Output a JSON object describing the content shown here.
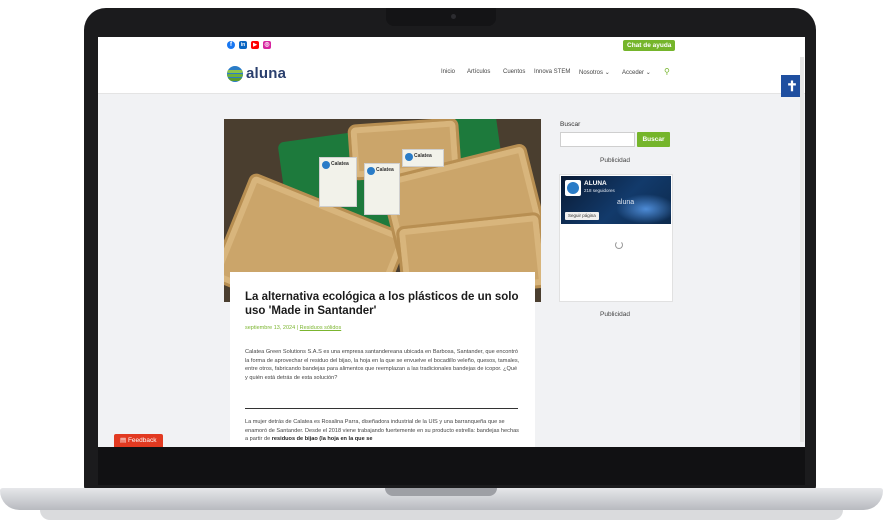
{
  "topbar": {
    "social_icons": [
      {
        "name": "facebook-icon",
        "glyph": "f",
        "color": "#1877f2"
      },
      {
        "name": "linkedin-icon",
        "glyph": "in",
        "color": "#0a66c2"
      },
      {
        "name": "youtube-icon",
        "glyph": "▶",
        "color": "#ff0000"
      },
      {
        "name": "instagram-icon",
        "glyph": "◎",
        "color": "#d6249f"
      }
    ],
    "help_label": "Chat de ayuda"
  },
  "header": {
    "logo_text": "aluna",
    "nav": {
      "inicio": "Inicio",
      "articulos": "Artículos",
      "cuentos": "Cuentos",
      "innova": "Innova STEM",
      "nosotros": "Nosotros",
      "acceder": "Acceder"
    },
    "chevron": "⌄",
    "search_glyph": "⚲",
    "accessibility_glyph": "✝"
  },
  "hero": {
    "labels": [
      "Calatea",
      "Calatea",
      "Calatea"
    ]
  },
  "article": {
    "title": "La alternativa ecológica a los plásticos de un solo uso 'Made in Santander'",
    "date": "septiembre 13, 2024",
    "separator": " | ",
    "category": "Residuos sólidos",
    "para1": "Calatea Green Solutions S.A.S es una empresa santandereana ubicada en Barbosa, Santander, que encontró la forma de aprovechar el residuo del bijao, la hoja en la que se envuelve el bocadillo veleño, quesos, tamales, entre otros, fabricando bandejas para alimentos que reemplazan a las tradicionales bandejas de icopor. ¿Qué y quién está detrás de esta solución?",
    "para2_text": "La mujer detrás de Calatea es Rosalina Parra, diseñadora industrial de la UIS y una barranqueña que se enamoró de Santander. Desde el 2018 viene trabajando fuertemente en su producto estrella: bandejas hechas a partir de ",
    "para2_bold": "residuos de bijao (la hoja en la que se"
  },
  "sidebar": {
    "search_label": "Buscar",
    "search_button": "Buscar",
    "publicidad_1": "Publicidad",
    "publicidad_2": "Publicidad",
    "fb": {
      "name": "ALUNA",
      "sub": "218 seguidores",
      "cover_logo": "aluna",
      "like_label": "Seguir página"
    }
  },
  "feedback_label": "Feedback",
  "colors": {
    "accent_green": "#75b52b",
    "brand_blue": "#2a3f6d",
    "feedback_red": "#e23a21",
    "accessibility_blue": "#1f4fa0"
  }
}
